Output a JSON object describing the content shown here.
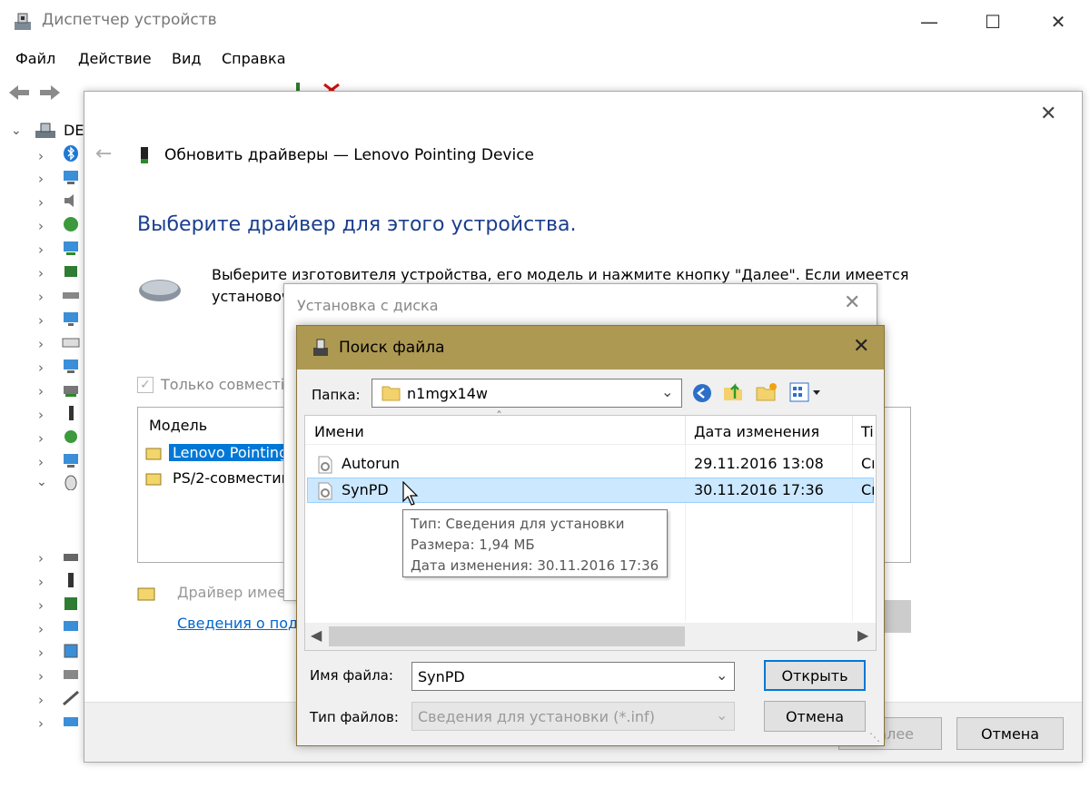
{
  "window": {
    "title": "Диспетчер устройств",
    "computer": "DE"
  },
  "menu": [
    "Файл",
    "Действие",
    "Вид",
    "Справка"
  ],
  "update_dialog": {
    "title": "Обновить драйверы — Lenovo Pointing Device",
    "heading": "Выберите драйвер для этого устройства.",
    "description_line1": "Выберите изготовителя устройства, его модель и нажмите кнопку \"Далее\". Если имеется",
    "description_line2": "установоч",
    "compat_checkbox": "Только совместі",
    "model_header": "Модель",
    "models": [
      "Lenovo Pointing",
      "PS/2-совместим"
    ],
    "signed_note": "Драйвер имее",
    "details_link": "Сведения о под",
    "next_button": "Далее",
    "cancel_button": "Отмена"
  },
  "install_dialog": {
    "title": "Установка с диска"
  },
  "find_dialog": {
    "title": "Поиск файла",
    "folder_label": "Папка:",
    "folder_value": "n1mgx14w",
    "columns": {
      "name": "Имени",
      "date": "Дата изменения",
      "type": "Ti"
    },
    "files": [
      {
        "name": "Autorun",
        "date": "29.11.2016 13:08",
        "type": "Cı"
      },
      {
        "name": "SynPD",
        "date": "30.11.2016 17:36",
        "type": "Cı"
      }
    ],
    "tooltip": {
      "type": "Тип: Сведения для установки",
      "size": "Размера: 1,94 МБ",
      "date": "Дата изменения: 30.11.2016 17:36"
    },
    "filename_label": "Имя файла:",
    "filename_value": "SynPD",
    "filetype_label": "Тип файлов:",
    "filetype_value": "Сведения для установки (*.inf)",
    "open_button": "Открыть",
    "cancel_button": "Отмена"
  },
  "colors": {
    "accent_heading": "#1a3e8e",
    "selection": "#cce8ff",
    "find_title": "#ad9952",
    "link": "#0066cc"
  }
}
